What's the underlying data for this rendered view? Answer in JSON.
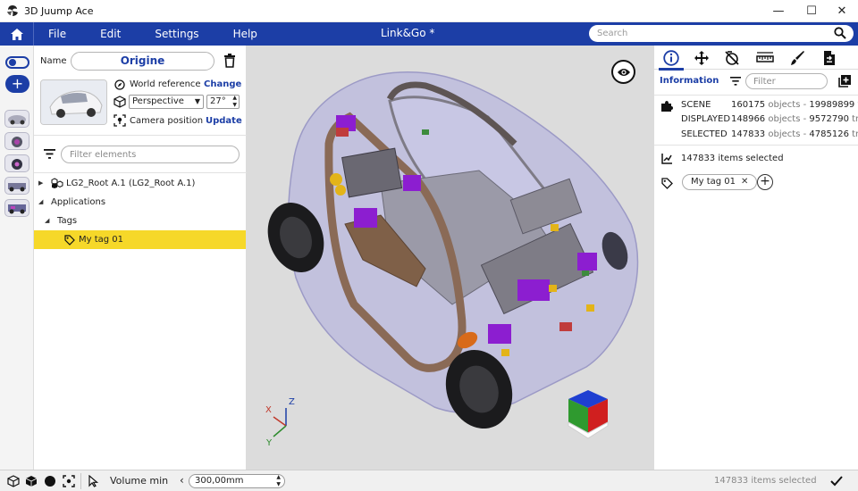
{
  "window": {
    "title": "3D Juump Ace",
    "minimize_glyph": "—",
    "maximize_glyph": "☐",
    "close_glyph": "✕"
  },
  "menubar": {
    "items": [
      "File",
      "Edit",
      "Settings",
      "Help"
    ],
    "document_title": "Link&Go *",
    "search_placeholder": "Search"
  },
  "camera": {
    "name_label": "Name",
    "name_value": "Origine",
    "world_reference_label": "World reference",
    "change_label": "Change",
    "projection_value": "Perspective",
    "fov_value": "27°",
    "camera_position_label": "Camera position",
    "update_label": "Update"
  },
  "tree": {
    "filter_placeholder": "Filter elements",
    "rows": [
      {
        "label": "LG2_Root A.1 (LG2_Root A.1)"
      },
      {
        "label": "Applications"
      },
      {
        "label": "Tags"
      },
      {
        "label": "My tag 01"
      }
    ]
  },
  "info_panel": {
    "title": "Information",
    "filter_placeholder": "Filter",
    "stats": [
      {
        "name": "SCENE",
        "objects": "160175",
        "objects_word": "objects",
        "sep": "-",
        "triangles": "19989899",
        "tri_word": "trian"
      },
      {
        "name": "DISPLAYED",
        "objects": "148966",
        "objects_word": "objects",
        "sep": "-",
        "triangles": "9572790",
        "tri_word": "trian"
      },
      {
        "name": "SELECTED",
        "objects": "147833",
        "objects_word": "objects",
        "sep": "-",
        "triangles": "4785126",
        "tri_word": "trian"
      }
    ],
    "items_selected": "147833 items selected",
    "tag_chip": "My tag 01",
    "chip_close": "✕",
    "add_glyph": "+"
  },
  "axes": {
    "x": "X",
    "y": "Y",
    "z": "Z"
  },
  "statusbar": {
    "volume_label": "Volume min",
    "volume_value": "300,00mm",
    "volume_chevron": "‹",
    "selected_text": "147833 items selected"
  },
  "colors": {
    "brand_blue": "#1c3ea6",
    "selection_yellow": "#f6d829",
    "viewport_bg": "#dcdcdc"
  }
}
